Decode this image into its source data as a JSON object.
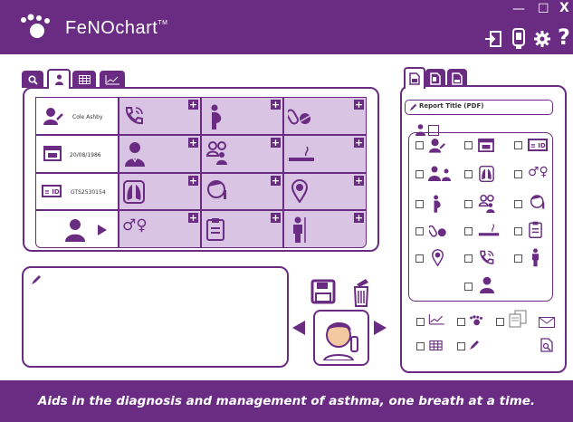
{
  "app": {
    "name": "FeNOchart",
    "trademark": "TM",
    "tagline": "Aids in the diagnosis and management of asthma, one breath at a time."
  },
  "window_controls": {
    "minimize": "—",
    "maximize": "☐",
    "close": "X"
  },
  "header_icons": [
    "sign-in-icon",
    "device-icon",
    "gear-icon",
    "help-icon"
  ],
  "patient_tabs": [
    "search-icon",
    "person-icon",
    "table-icon",
    "chart-icon"
  ],
  "patient": {
    "name": "Cole Ashby",
    "dob": "20/08/1986",
    "id": "GTS2530154"
  },
  "report": {
    "tabs": [
      "pdf-icon",
      "doc-icon",
      "db-icon"
    ],
    "title_label": "Report Title (PDF)"
  },
  "colors": {
    "brand": "#6a2c82",
    "cell": "#d9c4e3"
  }
}
